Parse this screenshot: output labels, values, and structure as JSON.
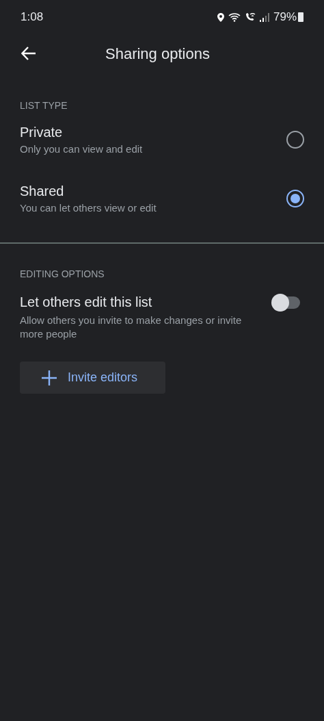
{
  "status_bar": {
    "time": "1:08",
    "battery": "79%"
  },
  "header": {
    "title": "Sharing options"
  },
  "list_type": {
    "heading": "LIST TYPE",
    "options": [
      {
        "title": "Private",
        "subtitle": "Only you can view and edit",
        "selected": false
      },
      {
        "title": "Shared",
        "subtitle": "You can let others view or edit",
        "selected": true
      }
    ]
  },
  "editing_options": {
    "heading": "EDITING OPTIONS",
    "title": "Let others edit this list",
    "subtitle": "Allow others you invite to make changes or invite more people",
    "on": false,
    "button": "Invite editors"
  }
}
